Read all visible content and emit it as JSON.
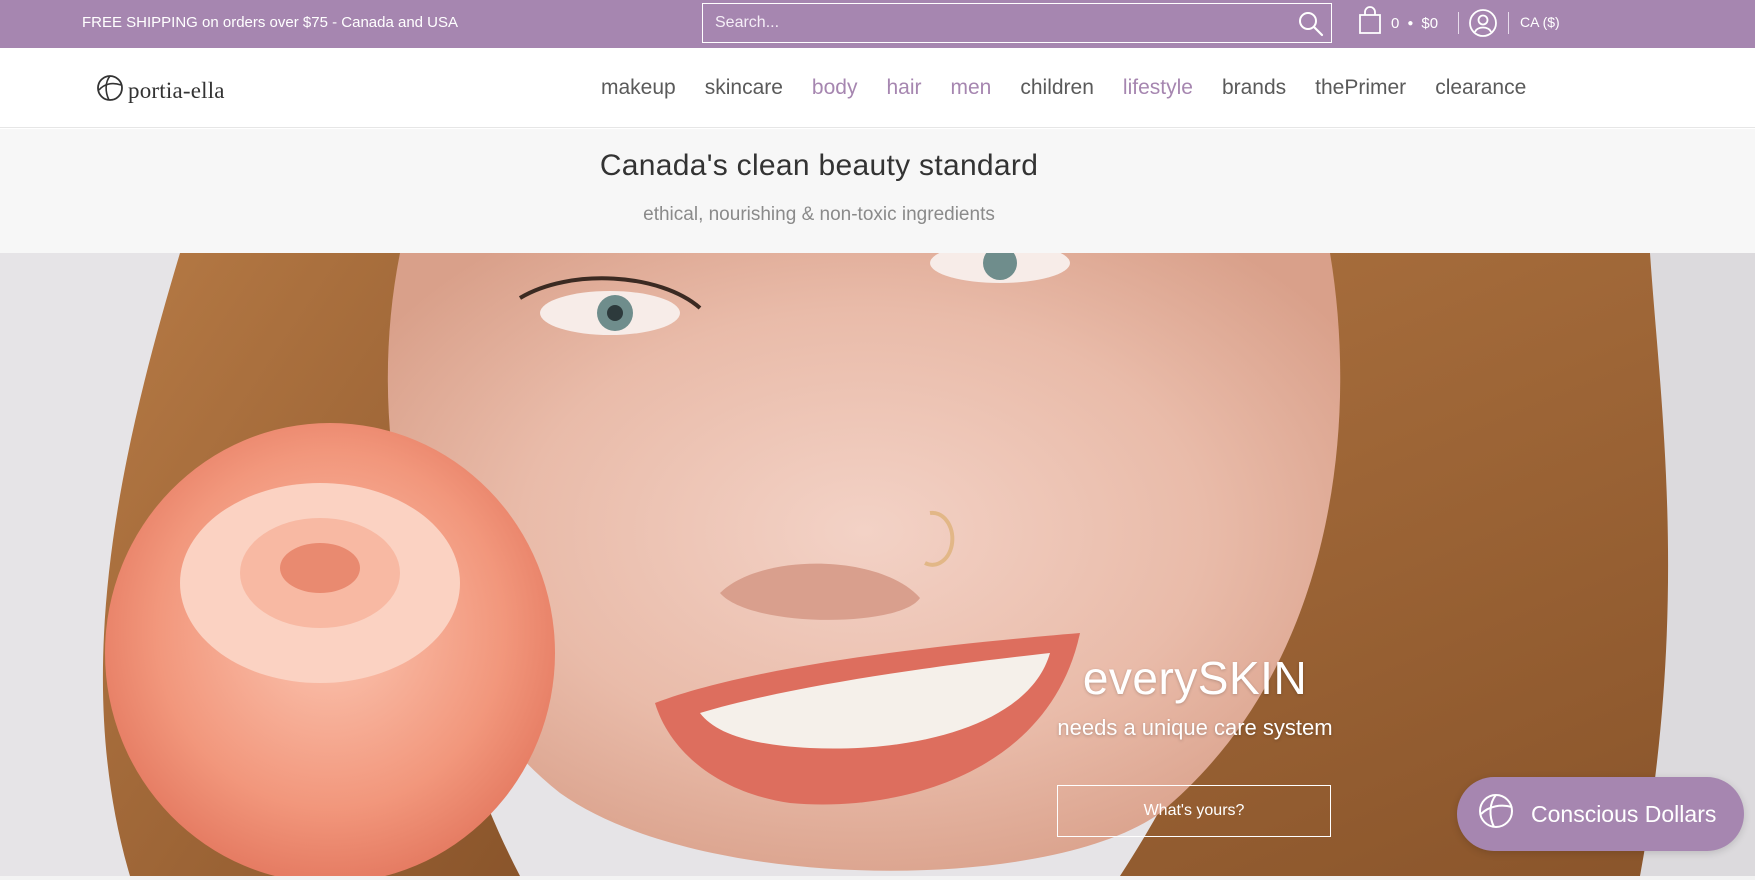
{
  "topbar": {
    "shipping_text": "FREE SHIPPING on orders over $75 - Canada and USA",
    "search_placeholder": "Search...",
    "cart_count": "0",
    "cart_total": "$0",
    "currency": "CA ($)"
  },
  "header": {
    "logo_text": "portia-ella",
    "nav": [
      {
        "label": "makeup",
        "accent": false
      },
      {
        "label": "skincare",
        "accent": false
      },
      {
        "label": "body",
        "accent": true
      },
      {
        "label": "hair",
        "accent": true
      },
      {
        "label": "men",
        "accent": true
      },
      {
        "label": "children",
        "accent": false
      },
      {
        "label": "lifestyle",
        "accent": true
      },
      {
        "label": "brands",
        "accent": false
      },
      {
        "label": "thePrimer",
        "accent": false
      },
      {
        "label": "clearance",
        "accent": false
      }
    ]
  },
  "tagline": {
    "title": "Canada's clean beauty standard",
    "subtitle": "ethical, nourishing & non-toxic ingredients"
  },
  "hero": {
    "title": "everySKIN",
    "subtitle": "needs a unique care system",
    "button_label": "What's yours?"
  },
  "rewards_pill": {
    "label": "Conscious Dollars"
  },
  "colors": {
    "brand": "#a686b0",
    "nav_text": "#5a5a5a",
    "tagband_bg": "#f7f7f7"
  },
  "icons": {
    "search": "search-icon",
    "cart": "cart-icon",
    "account": "user-icon",
    "logo": "logo-mark-icon",
    "rewards": "rewards-icon"
  }
}
